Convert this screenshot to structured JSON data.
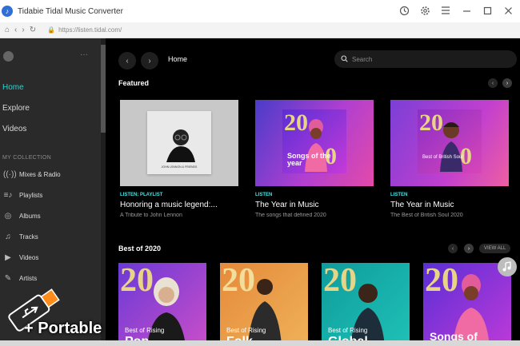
{
  "window": {
    "title": "Tidabie Tidal Music Converter"
  },
  "address": {
    "url": "https://listen.tidal.com/"
  },
  "sidebar": {
    "nav": [
      {
        "label": "Home",
        "active": true
      },
      {
        "label": "Explore",
        "active": false
      },
      {
        "label": "Videos",
        "active": false
      }
    ],
    "collection_label": "MY COLLECTION",
    "collection": [
      {
        "label": "Mixes & Radio",
        "icon": "radio-icon",
        "glyph": "((·))"
      },
      {
        "label": "Playlists",
        "icon": "playlist-icon",
        "glyph": "≡♪"
      },
      {
        "label": "Albums",
        "icon": "album-icon",
        "glyph": "◎"
      },
      {
        "label": "Tracks",
        "icon": "music-note-icon",
        "glyph": "♫"
      },
      {
        "label": "Videos",
        "icon": "video-icon",
        "glyph": "▶"
      },
      {
        "label": "Artists",
        "icon": "microphone-icon",
        "glyph": "🎙"
      }
    ]
  },
  "main": {
    "page_title": "Home",
    "search_placeholder": "Search",
    "featured": {
      "title": "Featured",
      "cards": [
        {
          "tag": "LISTEN: PLAYLIST",
          "title": "Honoring a music legend:...",
          "subtitle": "A Tribute to John Lennon",
          "art_text": "JOHN LENNON & FRIENDS"
        },
        {
          "tag": "LISTEN",
          "title": "The Year in Music",
          "subtitle": "The songs that defined 2020",
          "art_text": "Songs of the year"
        },
        {
          "tag": "LISTEN",
          "title": "The Year in Music",
          "subtitle": "The Best of British Soul 2020",
          "art_text": "Best of British Soul"
        }
      ]
    },
    "best2020": {
      "title": "Best of 2020",
      "view_all": "VIEW ALL",
      "cards": [
        {
          "line1": "Best of Rising",
          "line2": "Pop"
        },
        {
          "line1": "Best of Rising",
          "line2": "Folk"
        },
        {
          "line1": "Best of Rising",
          "line2": "Global"
        },
        {
          "line1": "",
          "line2": "Songs of"
        }
      ]
    }
  },
  "watermark": {
    "text": "+ Portable"
  },
  "colors": {
    "accent": "#29d3d3",
    "sidebar": "#2a2a2a",
    "main_bg": "#000000"
  }
}
